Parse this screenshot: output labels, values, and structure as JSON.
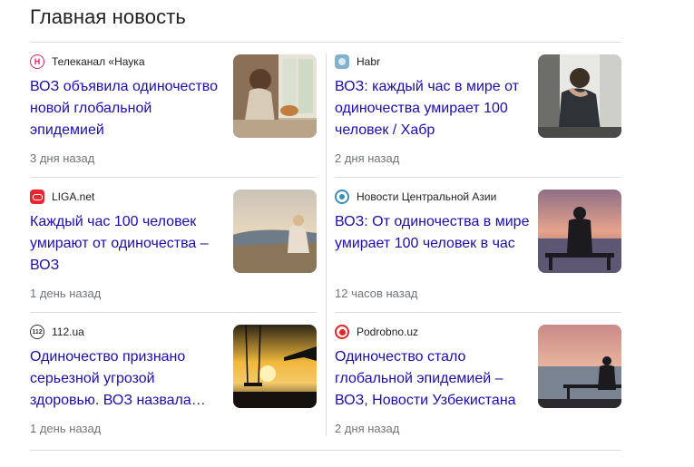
{
  "section": {
    "heading": "Главная новость"
  },
  "articles": [
    {
      "source": "Телеканал «Наука",
      "title": "ВОЗ объявила одиночество новой глобальной эпидемией",
      "time": "3 дня назад",
      "logo": "nauka-logo",
      "logo_color": "#e0245e",
      "thumb": "woman-window-cat-photo"
    },
    {
      "source": "Habr",
      "title": "ВОЗ: каждый час в мире от одиночества умирает 100 человек / Хабр",
      "time": "2 дня назад",
      "logo": "habr-logo",
      "logo_color": "#5b9bbf",
      "thumb": "sad-man-window-photo"
    },
    {
      "source": "LIGA.net",
      "title": "Каждый час 100 человек умирают от одиночества – ВОЗ",
      "time": "1 день назад",
      "logo": "liga-logo",
      "logo_color": "#e8262f",
      "thumb": "woman-sitting-hill-photo"
    },
    {
      "source": "Новости Центральной Азии",
      "title": "ВОЗ: От одиночества в мире умирает 100 человек в час",
      "time": "12 часов назад",
      "logo": "centralasia-logo",
      "logo_color": "#3a8fb7",
      "thumb": "man-bench-sunset-photo"
    },
    {
      "source": "112.ua",
      "title": "Одиночество признано серьезной угрозой здоровью. ВОЗ назвала…",
      "time": "1 день назад",
      "logo": "112ua-logo",
      "logo_color": "#333333",
      "thumb": "swing-sunset-photo"
    },
    {
      "source": "Podrobno.uz",
      "title": "Одиночество стало глобальной эпидемией – ВОЗ, Новости Узбекистана",
      "time": "2 дня назад",
      "logo": "podrobno-logo",
      "logo_color": "#e32626",
      "thumb": "man-bench-sea-photo"
    }
  ]
}
